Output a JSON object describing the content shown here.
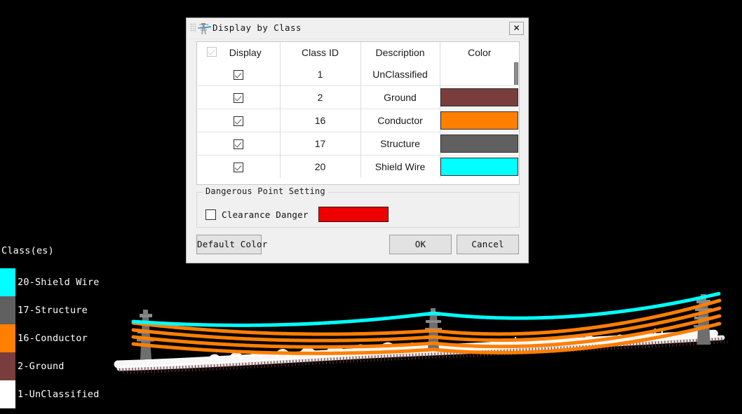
{
  "viewport": {
    "background_color": "#000000",
    "scene_description": "LiDAR point cloud of a power transmission line corridor with three lattice towers"
  },
  "legend": {
    "title": "Class(es)",
    "items": [
      {
        "label": "20-Shield Wire",
        "color": "#00ffff"
      },
      {
        "label": "17-Structure",
        "color": "#606060"
      },
      {
        "label": "16-Conductor",
        "color": "#ff7f00"
      },
      {
        "label": "2-Ground",
        "color": "#7a3d3d"
      },
      {
        "label": "1-UnClassified",
        "color": "#ffffff"
      }
    ]
  },
  "dialog": {
    "title": "Display by Class",
    "icon": "transmission-tower-icon",
    "close_label": "✕",
    "table": {
      "columns": [
        "Display",
        "Class ID",
        "Description",
        "Color"
      ],
      "header_checkbox_checked": true,
      "header_checkbox_disabled": true,
      "rows": [
        {
          "display": true,
          "class_id": "1",
          "description": "UnClassified",
          "description_dim": true,
          "color": "#ffffff",
          "color_empty": true
        },
        {
          "display": true,
          "class_id": "2",
          "description": "Ground",
          "description_dim": true,
          "color": "#7a3d3d",
          "color_empty": false
        },
        {
          "display": true,
          "class_id": "16",
          "description": "Conductor",
          "description_dim": false,
          "color": "#ff7f00",
          "color_empty": false
        },
        {
          "display": true,
          "class_id": "17",
          "description": "Structure",
          "description_dim": false,
          "color": "#606060",
          "color_empty": false
        },
        {
          "display": true,
          "class_id": "20",
          "description": "Shield Wire",
          "description_dim": false,
          "color": "#00ffff",
          "color_empty": false
        }
      ]
    },
    "danger_group": {
      "title": "Dangerous Point Setting",
      "checkbox_label": "Clearance Danger",
      "checkbox_checked": false,
      "color": "#ee0000"
    },
    "buttons": {
      "default_color": "Default Color",
      "ok": "OK",
      "cancel": "Cancel"
    }
  }
}
